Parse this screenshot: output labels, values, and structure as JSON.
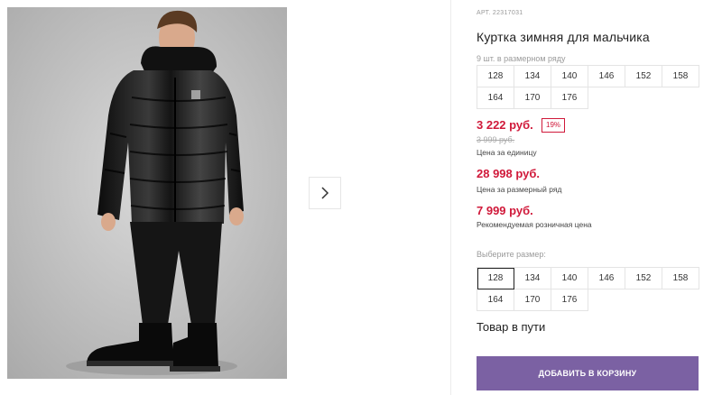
{
  "product": {
    "article": "АРТ. 22317031",
    "title": "Куртка зимняя для мальчика",
    "pack_label": "9 шт. в размерном ряду",
    "pack_sizes": [
      "128",
      "134",
      "140",
      "146",
      "152",
      "158",
      "164",
      "170",
      "176"
    ]
  },
  "prices": {
    "unit_price": "3 222 руб.",
    "discount": "19%",
    "old_price": "3 999 руб.",
    "unit_caption": "Цена за единицу",
    "pack_price": "28 998 руб.",
    "pack_caption": "Цена за размерный ряд",
    "rrp_price": "7 999 руб.",
    "rrp_caption": "Рекомендуемая розничная цена"
  },
  "size_select": {
    "label": "Выберите размер:",
    "sizes": [
      "128",
      "134",
      "140",
      "146",
      "152",
      "158",
      "164",
      "170",
      "176"
    ],
    "selected": "128"
  },
  "status": "Товар в пути",
  "add_to_cart_label": "ДОБАВИТЬ В КОРЗИНУ",
  "colors": {
    "accent_price": "#d0193a",
    "cart_button": "#7b61a3"
  },
  "icons": {
    "next": "chevron-right-icon"
  }
}
